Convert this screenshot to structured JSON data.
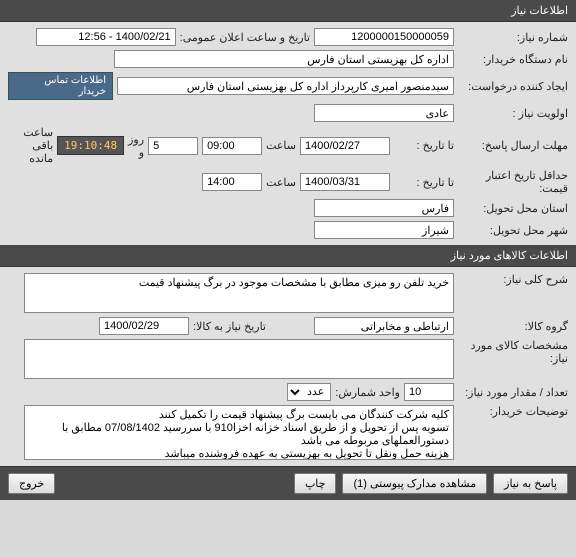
{
  "section1": {
    "title": "اطلاعات نیاز",
    "request_no_label": "شماره نیاز:",
    "request_no": "1200000150000059",
    "public_datetime_label": "تاریخ و ساعت اعلان عمومی:",
    "public_datetime": "1400/02/21 - 12:56",
    "buyer_label": "نام دستگاه خریدار:",
    "buyer": "اداره کل بهزیستی استان فارس",
    "creator_label": "ایجاد کننده درخواست:",
    "creator": "سیدمنصور امیری کارپرداز اداره کل بهزیستی استان فارس",
    "contact_btn": "اطلاعات تماس خریدار",
    "priority_label": "اولویت نیاز :",
    "priority": "عادی",
    "deadline_label": "مهلت ارسال پاسخ:",
    "to_date_label": "تا تاریخ :",
    "deadline_date": "1400/02/27",
    "time_label": "ساعت",
    "deadline_time": "09:00",
    "remain_days": "5",
    "day_and_label": "روز و",
    "remain_time": "19:10:48",
    "remain_suffix": "ساعت باقی مانده",
    "min_validity_label": "حداقل تاریخ اعتبار قیمت:",
    "min_validity_date": "1400/03/31",
    "min_validity_time": "14:00",
    "delivery_province_label": "استان محل تحویل:",
    "delivery_province": "فارس",
    "delivery_city_label": "شهر محل تحویل:",
    "delivery_city": "شیراز"
  },
  "section2": {
    "title": "اطلاعات کالاهای مورد نیاز",
    "general_desc_label": "شرح کلی نیاز:",
    "general_desc": "خرید تلفن رو میزی مطابق با مشخصات موجود در برگ پیشنهاد قیمت",
    "group_label": "گروه کالا:",
    "group": "ارتباطی و مخابراتی",
    "need_by_label": "تاریخ نیاز به کالا:",
    "need_by": "1400/02/29",
    "specs_label": "مشخصات کالای مورد نیاز:",
    "specs": "",
    "qty_label": "تعداد / مقدار مورد نیاز:",
    "qty": "10",
    "unit_label": "واحد شمارش:",
    "unit": "عدد",
    "notes_label": "توضیحات خریدار:",
    "notes": "کلیه شرکت کنندگان می بایست برگ پیشنهاد قیمت را تکمیل کنند\nتسویه پس از تحویل و از طریق اسناد خزانه اخزا910 با سررسید 07/08/1402 مطابق با دستورالعملهای مربوطه می باشد\nهزینه حمل ونقل تا تحویل به بهزیستی به عهده فروشنده میباشد"
  },
  "buttons": {
    "reply": "پاسخ به نیاز",
    "view_attach": "مشاهده مدارک پیوستی (1)",
    "print": "چاپ",
    "exit": "خروج"
  }
}
